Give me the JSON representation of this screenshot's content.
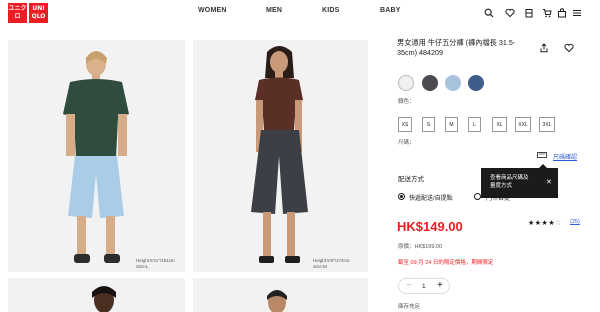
{
  "header": {
    "logo_top": "ユニクロ",
    "logo_bottom": "UNI QLO",
    "nav": [
      "WOMEN",
      "MEN",
      "KIDS",
      "BABY"
    ],
    "icons": [
      "search-icon",
      "heart-icon",
      "account-icon",
      "cart-icon",
      "store-icon",
      "menu-icon"
    ]
  },
  "gallery": {
    "caption1": "Height:5'11\"/181cm\nSize:L",
    "caption2": "Height:5'9\"/174cm\nSize:M"
  },
  "product": {
    "title": "男女通用 牛仔五分褲 (褲內檔長 31.5-35cm) 484209",
    "color_label": "顏色：",
    "colors": [
      "#f0f0f0",
      "#4a4c52",
      "#a7c2dc",
      "#3e5e8a"
    ],
    "sizes": [
      "XS",
      "S",
      "M",
      "L",
      "XL",
      "XXL",
      "3XL"
    ],
    "size_label": "尺碼：",
    "size_confirm": "尺碼確認",
    "tooltip_line1": "查看商品尺碼及",
    "tooltip_line2": "量度方式",
    "delivery_heading": "配送方式",
    "delivery_option1": "快遞配送/自提點",
    "delivery_option2": "門市自提",
    "price": "HK$149.00",
    "rating_count": "(25)",
    "rating_value": 4.5,
    "original_price": "原價：HK$199.00",
    "promo": "截至 09 月 24 日的限定價格，期間限定",
    "quantity": "1",
    "stock": "庫存充足"
  },
  "colors": {
    "brand_red": "#ed1d24",
    "link_blue": "#2d5bd6"
  }
}
